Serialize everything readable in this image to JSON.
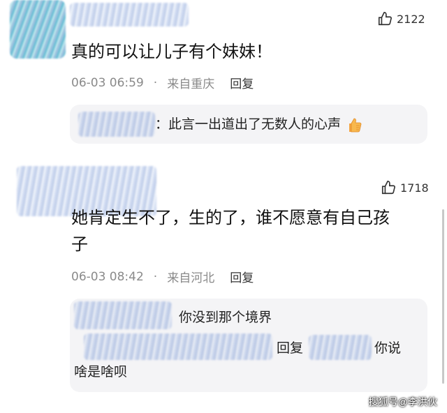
{
  "comments": [
    {
      "text": "真的可以让儿子有个妹妹！",
      "likes": "2122",
      "time": "06-03 06:59",
      "location": "来自重庆",
      "reply_label": "回复",
      "reply_preview": {
        "separator": "：",
        "text": "此言一出道出了无数人的心声",
        "emoji": "thumbs-up-emoji"
      }
    },
    {
      "text_line1": "她肯定生不了，生的了，谁不愿意有自己孩",
      "text_line2": "子",
      "likes": "1718",
      "time": "06-03 08:42",
      "location": "来自河北",
      "reply_label": "回复",
      "reply_preview": {
        "line1": "你没到那个境界",
        "reply_word": "回复",
        "line2_end": "你说",
        "line3": "啥是啥呗"
      }
    }
  ],
  "watermark": "搜狐号@李洪伙",
  "icons": {
    "like": "thumbs-up-icon"
  },
  "colors": {
    "meta": "#8a8a8a",
    "reply_bg": "#f4f4f6"
  }
}
